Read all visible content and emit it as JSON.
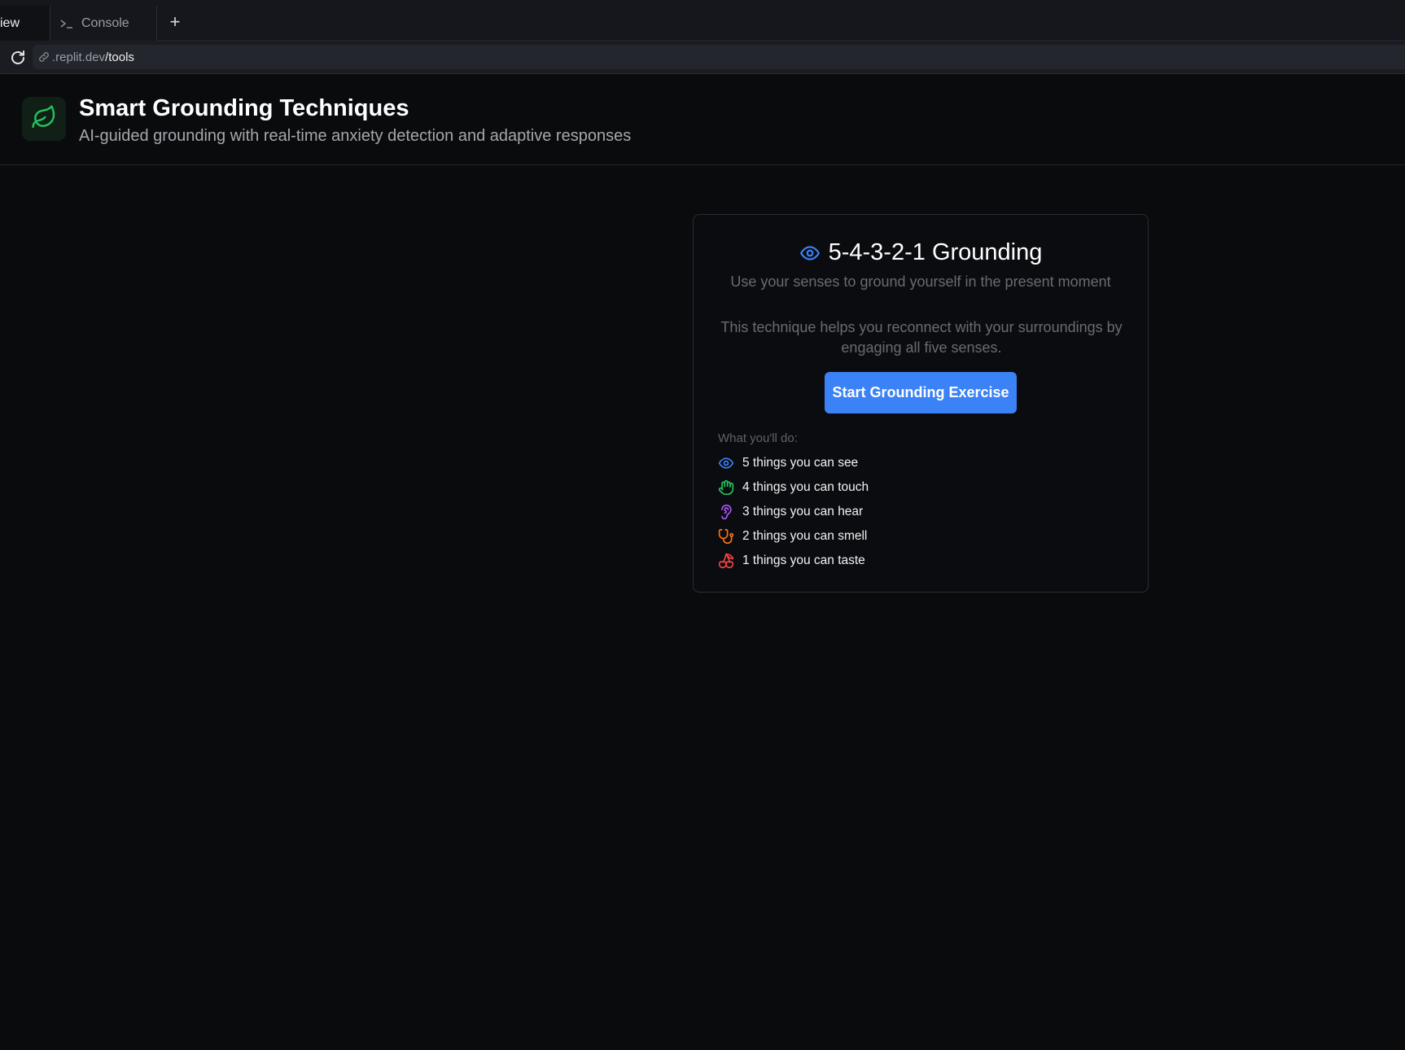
{
  "browser": {
    "tabs": [
      {
        "label": "iew",
        "active": true
      },
      {
        "label": "Console",
        "active": false,
        "icon": "terminal-prompt-icon"
      }
    ],
    "new_tab_label": "+",
    "url": {
      "host": ".replit.dev",
      "path": "/tools"
    }
  },
  "header": {
    "logo_icon": "leaf-icon",
    "title": "Smart Grounding Techniques",
    "subtitle": "AI-guided grounding with real-time anxiety detection and adaptive responses"
  },
  "card": {
    "title_icon": "eye-icon",
    "title": "5-4-3-2-1 Grounding",
    "subtitle": "Use your senses to ground yourself in the present moment",
    "description": "This technique helps you reconnect with your surroundings by engaging all five senses.",
    "start_button": "Start Grounding Exercise",
    "list_heading": "What you'll do:",
    "senses": [
      {
        "icon": "eye-icon",
        "color": "#3b82f6",
        "label": "5 things you can see"
      },
      {
        "icon": "hand-icon",
        "color": "#22c55e",
        "label": "4 things you can touch"
      },
      {
        "icon": "ear-icon",
        "color": "#a855f7",
        "label": "3 things you can hear"
      },
      {
        "icon": "nose-icon",
        "color": "#f97316",
        "label": "2 things you can smell"
      },
      {
        "icon": "cherry-icon",
        "color": "#ef4444",
        "label": "1 things you can taste"
      }
    ]
  },
  "colors": {
    "background": "#0a0b0d",
    "accent": "#3b82f6",
    "logo": "#22c55e"
  }
}
